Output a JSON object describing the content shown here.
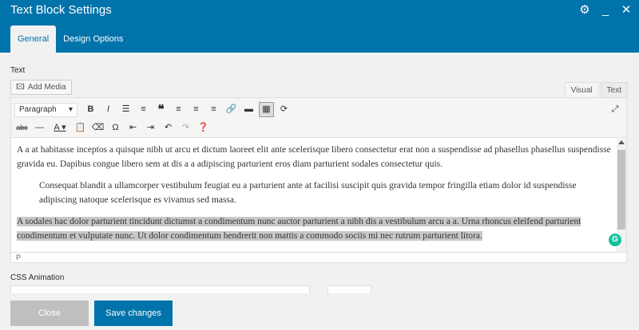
{
  "header": {
    "title": "Text Block Settings",
    "tabs": [
      {
        "label": "General",
        "active": true
      },
      {
        "label": "Design Options",
        "active": false
      }
    ],
    "icons": [
      "gear-icon",
      "minimize-icon",
      "close-icon"
    ]
  },
  "field": {
    "label": "Text",
    "add_media_label": "Add Media"
  },
  "editor_modes": [
    {
      "label": "Visual",
      "active": true
    },
    {
      "label": "Text",
      "active": false
    }
  ],
  "toolbar": {
    "format_select": "Paragraph"
  },
  "content": {
    "paragraph1": "A a at habitasse inceptos a quisque nibh ut arcu et dictum laoreet elit ante scelerisque libero consectetur erat non a suspendisse ad phasellus phasellus suspendisse gravida eu. Dapibus congue libero sem at dis a a adipiscing parturient eros diam parturient sodales consectetur quis.",
    "blockquote": "Consequat blandit a ullamcorper vestibulum feugiat eu a parturient ante at facilisi suscipit quis gravida tempor fringilla etiam dolor id suspendisse adipiscing natoque scelerisque es vivamus sed massa.",
    "paragraph2": "A sodales hac dolor parturient tincidunt dictumst a condimentum nunc auctor parturient a nibh dis a vestibulum arcu a a. Urna rhoncus eleifend parturient condimentum et vulputate nunc. Ut dolor condimentum hendrerit non mattis a commodo sociis mi nec rutrum parturient litora."
  },
  "path_bar": "P",
  "css_animation": {
    "label": "CSS Animation"
  },
  "footer": {
    "close_label": "Close",
    "save_label": "Save changes"
  },
  "colors": {
    "header_bg": "#0073aa",
    "close_bg": "#bfbfbf",
    "save_bg": "#0073aa",
    "selection": "#c8c8c8"
  }
}
